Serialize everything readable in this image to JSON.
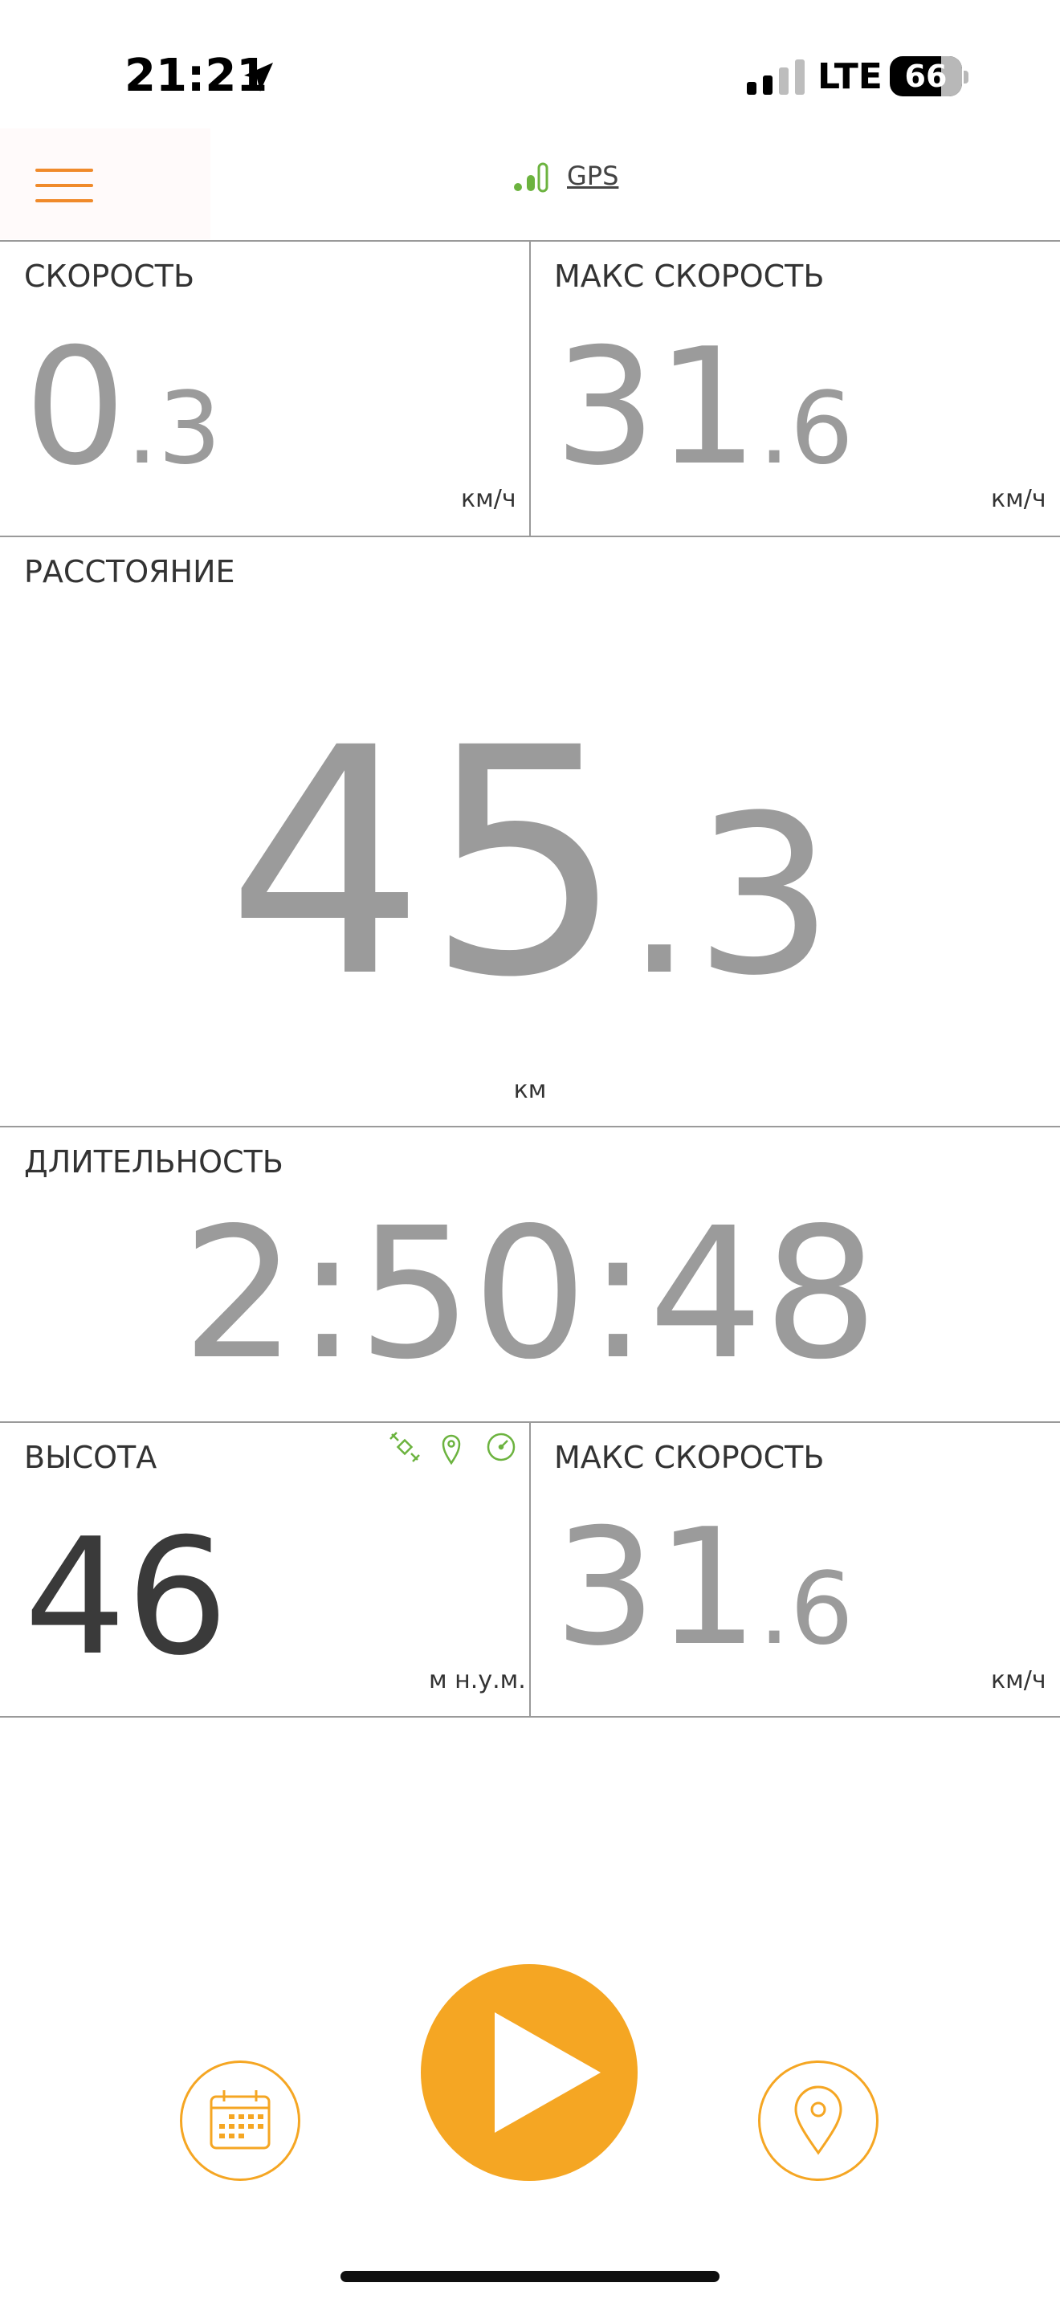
{
  "status_bar": {
    "time": "21:21",
    "network": "LTE",
    "battery": "66"
  },
  "header": {
    "gps_label": "GPS"
  },
  "tiles": {
    "speed": {
      "label": "СКОРОСТЬ",
      "int": "0",
      "frac": ".3",
      "unit": "км/ч"
    },
    "max_speed_top": {
      "label": "МАКС СКОРОСТЬ",
      "int": "31",
      "frac": ".6",
      "unit": "км/ч"
    },
    "distance": {
      "label": "РАССТОЯНИЕ",
      "int": "45",
      "frac": ".3",
      "unit": "км"
    },
    "duration": {
      "label": "ДЛИТЕЛЬНОСТЬ",
      "value": "2:50:48"
    },
    "altitude": {
      "label": "ВЫСОТА",
      "value": "46",
      "unit": "м н.у.м."
    },
    "max_speed_bottom": {
      "label": "МАКС СКОРОСТЬ",
      "int": "31",
      "frac": ".6",
      "unit": "км/ч"
    }
  },
  "colors": {
    "accent": "#f5a623",
    "menu": "#f08a2a",
    "gps_green": "#6cb33f",
    "value_gray": "#9b9b9b",
    "divider": "#9a9a9a"
  },
  "icons": {
    "menu": "hamburger-icon",
    "gps": "signal-bars-icon",
    "altitude_sources": [
      "satellite-icon",
      "map-pin-icon",
      "barometer-icon"
    ],
    "left_button": "calendar-icon",
    "center_button": "play-icon",
    "right_button": "map-pin-icon"
  }
}
